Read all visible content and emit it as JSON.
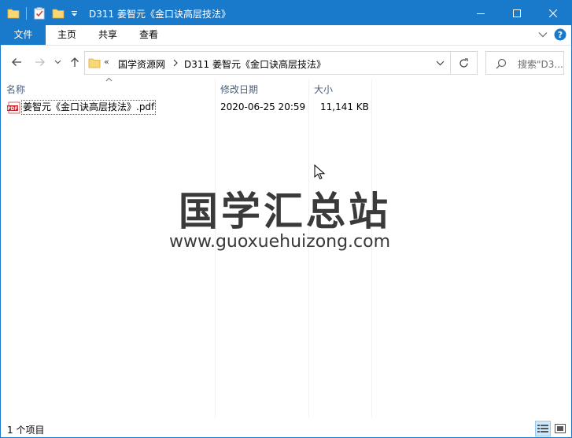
{
  "window": {
    "title": "D311 姜智元《金口诀高层技法》"
  },
  "ribbon": {
    "tabs": [
      "文件",
      "主页",
      "共享",
      "查看"
    ]
  },
  "address": {
    "overflow": "«",
    "crumbs": [
      "国学资源网",
      "D311 姜智元《金口诀高层技法》"
    ],
    "search_placeholder": "搜索\"D3..."
  },
  "columns": {
    "name": "名称",
    "date": "修改日期",
    "size": "大小"
  },
  "files": [
    {
      "name": "姜智元《金口诀高层技法》.pdf",
      "date": "2020-06-25 20:59",
      "size": "11,141 KB",
      "icon": "pdf-file-icon"
    }
  ],
  "watermark": {
    "title": "国学汇总站",
    "url": "www.guoxuehuizong.com"
  },
  "status": {
    "count": "1 个项目"
  },
  "colors": {
    "accent": "#1979ca",
    "selection": "#cce8ff",
    "header_text": "#4c607a"
  }
}
